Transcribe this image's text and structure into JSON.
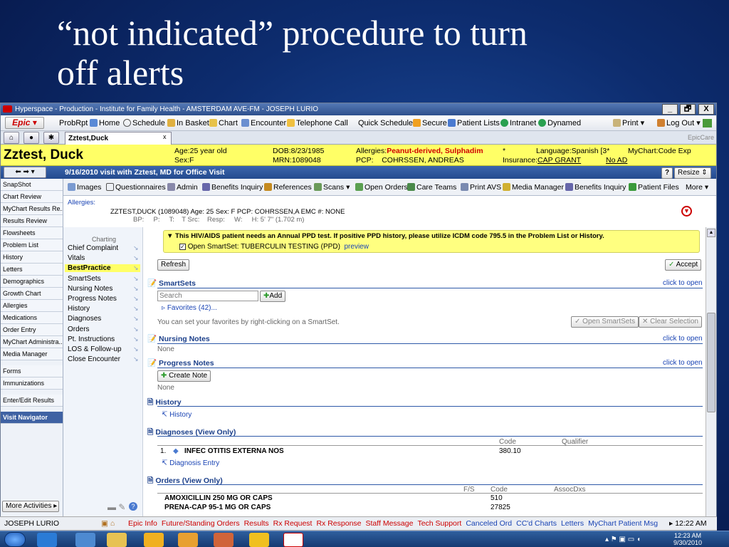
{
  "slide": {
    "title_line1": "“not indicated” procedure to turn",
    "title_line2": "off alerts"
  },
  "window": {
    "title": "Hyperspace - Production - Institute for Family Health - AMSTERDAM AVE-FM - JOSEPH LURIO",
    "min": "_",
    "max": "🗗",
    "close": "X"
  },
  "menu": {
    "epic": "Epic ▾",
    "items": [
      "ProbRpt",
      "Home",
      "Schedule",
      "In Basket",
      "Chart",
      "Encounter",
      "Telephone Call",
      "Quick Schedule",
      "Secure",
      "Patient Lists",
      "Intranet",
      "Dynamed"
    ],
    "print": "Print ▾",
    "logout": "Log Out ▾"
  },
  "tabs": {
    "patient_tab": "Zztest,Duck",
    "close": "x",
    "epiccare": "EpicCare"
  },
  "header": {
    "name": "Zztest, Duck",
    "age": "Age:25 year old",
    "sex": "Sex:F",
    "dob": "DOB:8/23/1985",
    "mrn": "MRN:1089048",
    "allergies_label": "Allergies:",
    "allergies": "Peanut-derived, Sulphadim",
    "pcp_label": "PCP:",
    "pcp": "COHRSSEN, ANDREAS",
    "star": "*",
    "language": "Language:Spanish [3*",
    "insurance_label": "Insurance:",
    "insurance": "CAP GRANT",
    "mychart": "MyChart:Code Exp",
    "no_ad": "No AD"
  },
  "visit": {
    "title": "9/16/2010 visit with Zztest, MD for Office Visit",
    "help": "?",
    "resize": "Resize ⇕"
  },
  "sidebar": [
    "SnapShot",
    "Chart Review",
    "MyChart Results Re...",
    "Results Review",
    "Flowsheets",
    "Problem List",
    "History",
    "Letters",
    "Demographics",
    "Growth Chart",
    "Allergies",
    "Medications",
    "Order Entry",
    "MyChart Administra...",
    "Media Manager",
    "Forms",
    "Immunizations",
    "Enter/Edit Results",
    "Visit Navigator"
  ],
  "more_activities": "More Activities ▸",
  "toolbar": [
    "Images",
    "Questionnaires",
    "Admin",
    "Benefits Inquiry",
    "References",
    "Scans ▾",
    "Open Orders",
    "Care Teams",
    "Print AVS",
    "Media Manager",
    "Benefits Inquiry",
    "Patient Files",
    "More ▾"
  ],
  "allergy_block": {
    "label": "Allergies:",
    "info": "ZZTEST,DUCK (1089048) Age: 25 Sex: F PCP: COHRSSEN,A EMC #: NONE",
    "vitals": "BP:     P:     T:    T Src:    Resp:     W:     H: 5' 7\" (1.702 m)"
  },
  "charting": {
    "header": "Charting",
    "items": [
      "Chief Complaint",
      "Vitals",
      "BestPractice",
      "SmartSets",
      "Nursing Notes",
      "Progress Notes",
      "History",
      "Diagnoses",
      "Orders",
      "Pt. Instructions",
      "LOS & Follow-up",
      "Close Encounter"
    ]
  },
  "alert": {
    "text": "This HIV/AIDS patient needs an Annual PPD test. If positive PPD history, please utilize ICDM code 795.5 in the Problem List or History.",
    "checkbox": "Open SmartSet: TUBERCULIN TESTING (PPD)",
    "preview": "preview"
  },
  "buttons": {
    "refresh": "Refresh",
    "accept": "Accept",
    "add": "Add",
    "create_note": "Create Note",
    "open_smartsets": "Open SmartSets",
    "clear_selection": "Clear Selection"
  },
  "smartsets": {
    "title": "SmartSets",
    "click": "click to open",
    "search_placeholder": "Search",
    "favorites": "Favorites (42)...",
    "hint": "You can set your favorites by right-clicking on a SmartSet."
  },
  "nursing": {
    "title": "Nursing Notes",
    "click": "click to open",
    "none": "None"
  },
  "progress": {
    "title": "Progress Notes",
    "click": "click to open",
    "none": "None"
  },
  "history": {
    "title": "History",
    "link": "History"
  },
  "diagnoses": {
    "title": "Diagnoses (View Only)",
    "col_code": "Code",
    "col_qual": "Qualifier",
    "row_num": "1.",
    "row_name": "INFEC OTITIS EXTERNA NOS",
    "row_code": "380.10",
    "link": "Diagnosis Entry"
  },
  "orders": {
    "title": "Orders (View Only)",
    "col_fs": "F/S",
    "col_code": "Code",
    "col_assoc": "AssocDxs",
    "rows": [
      {
        "name": "AMOXICILLIN 250 MG OR CAPS",
        "code": "510"
      },
      {
        "name": "PRENA-CAP 95-1 MG OR CAPS",
        "code": "27825"
      }
    ]
  },
  "status": {
    "user": "JOSEPH LURIO",
    "items": [
      "Epic Info",
      "Future/Standing Orders",
      "Results",
      "Rx Request",
      "Rx Response",
      "Staff Message",
      "Tech Support",
      "Canceled Ord",
      "CC'd Charts",
      "Letters",
      "MyChart Patient Msg"
    ],
    "time": "12:22 AM"
  },
  "taskbar": {
    "time": "12:23 AM",
    "date": "9/30/2010"
  },
  "colors": {
    "header_yellow": "#ffff66",
    "nav_blue": "#2d4f8c",
    "status_red": "#cc0000",
    "link_blue": "#1a44b4"
  }
}
